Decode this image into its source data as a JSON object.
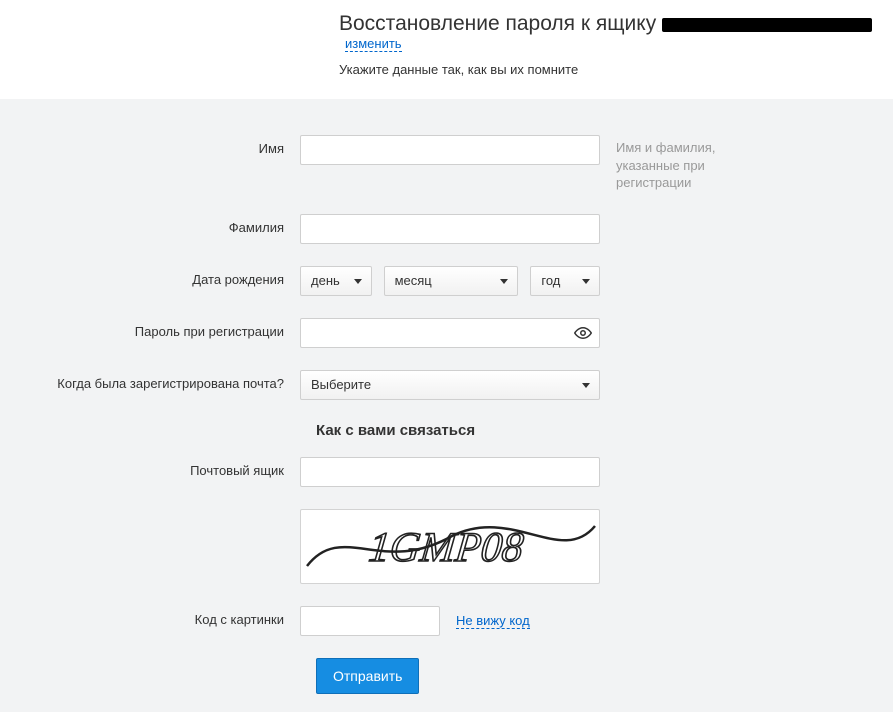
{
  "header": {
    "title": "Восстановление пароля к ящику",
    "change_link": "изменить",
    "subtitle": "Укажите данные так, как вы их помните"
  },
  "labels": {
    "first_name": "Имя",
    "last_name": "Фамилия",
    "dob": "Дата рождения",
    "password_reg": "Пароль при регистрации",
    "when_registered": "Когда была зарегистрирована почта?",
    "mailbox": "Почтовый ящик",
    "captcha_code": "Код с картинки"
  },
  "hints": {
    "name_hint": "Имя и фамилия, указанные при регистрации"
  },
  "selects": {
    "day": "день",
    "month": "месяц",
    "year": "год",
    "when_registered_value": "Выберите"
  },
  "section": {
    "contact_title": "Как с вами связаться"
  },
  "captcha": {
    "cant_see": "Не вижу код",
    "image_text": "1GMP08"
  },
  "buttons": {
    "submit": "Отправить"
  },
  "fields": {
    "first_name": "",
    "last_name": "",
    "password": "",
    "mailbox": "",
    "captcha_code": ""
  }
}
